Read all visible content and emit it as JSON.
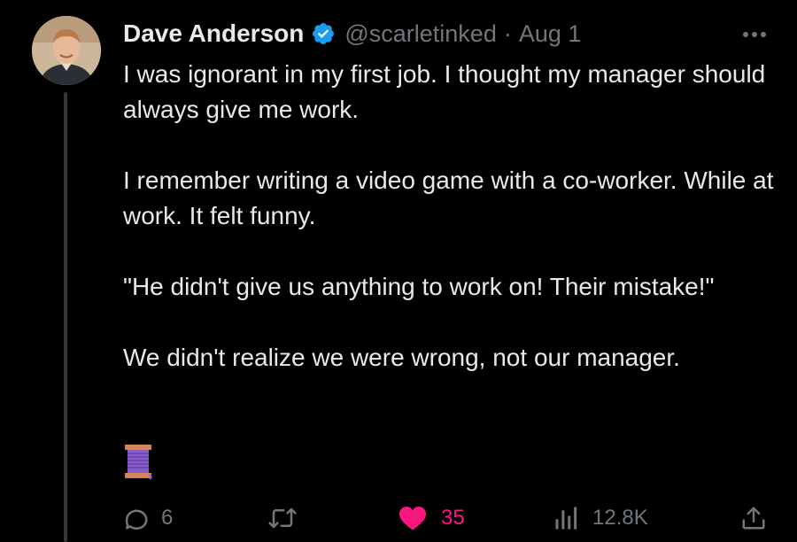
{
  "author": {
    "name": "Dave Anderson",
    "handle": "@scarletinked",
    "separator": "·",
    "time": "Aug 1",
    "verified_color": "#1d9bf0"
  },
  "tweet": {
    "paragraphs": [
      "I was ignorant in my first job. I thought my manager should always give me work.",
      "I remember writing a video game with a co-worker. While at work. It felt funny.",
      "\"He didn't give us anything to work on! Their mistake!\"",
      "We didn't realize we were wrong, not our manager."
    ],
    "emoji": "thread-spool-icon"
  },
  "actions": {
    "replies": "6",
    "retweets": "",
    "likes": "35",
    "views": "12.8K"
  },
  "colors": {
    "background": "#000000",
    "text": "#e7e9ea",
    "muted": "#71767b",
    "like": "#f91880",
    "verified": "#1d9bf0"
  }
}
